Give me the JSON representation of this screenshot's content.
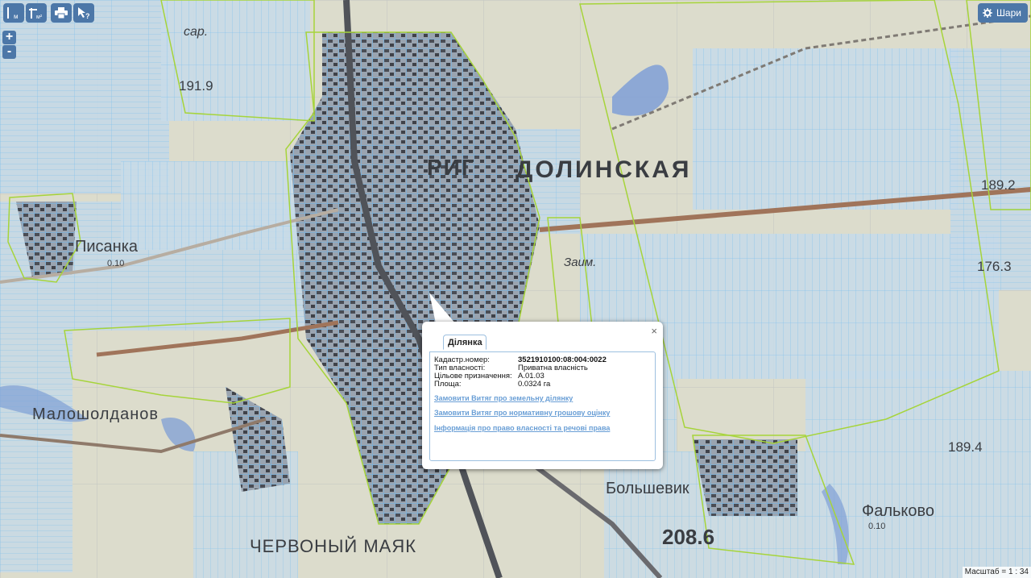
{
  "toolbar": {
    "measure_length_label": "м",
    "measure_area_label": "м²",
    "print_icon": "printer-icon",
    "identify_icon": "pointer-help-icon"
  },
  "zoom": {
    "in_label": "+",
    "out_label": "-"
  },
  "layers_button": {
    "label": "Шари",
    "icon": "gear-icon"
  },
  "map_labels": {
    "town": "ДОЛИНСКАЯ",
    "town_prefix": "РИГ",
    "village_west": "Писанка",
    "village_west_sub": "0.10",
    "village_sw": "Малошолданов",
    "village_se": "Большевик",
    "village_east": "Фальково",
    "village_east_sub": "0.10",
    "village_south": "ЧЕРВОНЫЙ МАЯК",
    "height_1": "191.9",
    "height_2": "189.2",
    "height_3": "176.3",
    "height_4": "189.4",
    "height_5": "208.6",
    "sar": "сар.",
    "zaim": "Заим."
  },
  "popup": {
    "tab": "Ділянка",
    "close": "×",
    "fields": [
      {
        "label": "Кадастр.номер:",
        "value": "3521910100:08:004:0022",
        "bold": true
      },
      {
        "label": "Тип власності:",
        "value": "Приватна власність",
        "bold": false
      },
      {
        "label": "Цільове призначення:",
        "value": "A.01.03",
        "bold": false
      },
      {
        "label": "Площа:",
        "value": "0.0324 га",
        "bold": false
      }
    ],
    "links": [
      "Замовити Витяг про земельну ділянку",
      "Замовити Витяг про нормативну грошову оцінку",
      "Інформація про право власності та речові права"
    ]
  },
  "scale": {
    "label": "Масштаб = 1 : 34"
  },
  "colors": {
    "button": "#4c77a8",
    "parcel_line": "#7fc2ef",
    "boundary": "#a6d43a",
    "water": "#7f9fd6",
    "link": "#6a9fd6"
  }
}
